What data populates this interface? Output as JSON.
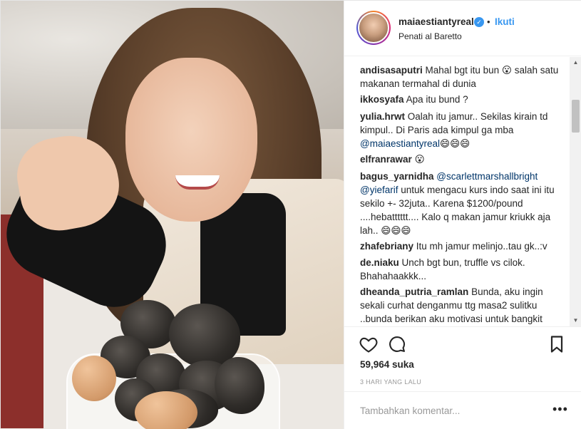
{
  "post": {
    "username": "maiaestiantyreal",
    "separator": "•",
    "follow_label": "Ikuti",
    "location": "Penati al Baretto",
    "verified_icon": "verified-badge-icon",
    "accent_color": "#3897f0"
  },
  "comments": [
    {
      "user": "andisasaputri",
      "text": "Mahal bgt itu bun 😮 salah satu makanan termahal di dunia"
    },
    {
      "user": "ikkosyafa",
      "text": "Apa itu bund ?"
    },
    {
      "user": "yulia.hrwt",
      "text": "Oalah itu jamur.. Sekilas kirain td kimpul.. Di Paris ada kimpul ga mba",
      "mention": "@maiaestiantyreal",
      "after": "😄😄😄"
    },
    {
      "user": "elfranrawar",
      "text": "😮"
    },
    {
      "user": "bagus_yarnidha",
      "mention": "@scarlettmarshallbright",
      "mention2": "@yiefarif",
      "text": "untuk mengacu kurs indo saat ini itu sekilo +- 32juta.. Karena $1200/pound ....hebatttttt.... Kalo q makan jamur kriukk aja lah.. 😄😄😄"
    },
    {
      "user": "zhafebriany",
      "text": "Itu mh jamur melinjo..tau gk..:v"
    },
    {
      "user": "de.niaku",
      "text": "Unch bgt bun, truffle vs cilok. Bhahahaakkk..."
    },
    {
      "user": "dheanda_putria_ramlan",
      "text": "Bunda, aku ingin sekali curhat denganmu ttg masa2 sulitku ..bunda berikan aku motivasi untuk bangkit"
    }
  ],
  "actions": {
    "icons": [
      "heart-icon",
      "comment-icon",
      "bookmark-icon"
    ],
    "likes": "59,964 suka",
    "timestamp": "3 HARI YANG LALU"
  },
  "add_comment": {
    "placeholder": "Tambahkan komentar...",
    "more_label": "•••"
  },
  "scrollbar": {
    "up_icon": "▲",
    "down_icon": "▼"
  }
}
